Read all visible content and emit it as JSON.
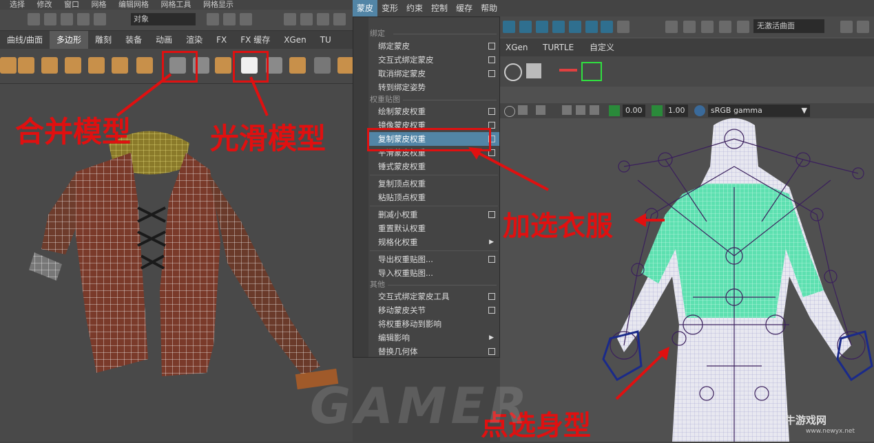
{
  "left": {
    "menubar": [
      "选择",
      "修改",
      "窗口",
      "网格",
      "编辑网格",
      "网格工具",
      "网格显示"
    ],
    "object_field": "对象",
    "tabs": [
      "曲线/曲面",
      "多边形",
      "雕刻",
      "装备",
      "动画",
      "渲染",
      "FX",
      "FX 缓存",
      "XGen",
      "TU"
    ],
    "active_tab": "多边形"
  },
  "menu": {
    "bar": [
      "蒙皮",
      "变形",
      "约束",
      "控制",
      "缓存",
      "帮助"
    ],
    "active": "蒙皮",
    "sections": {
      "bind": "绑定",
      "weight_maps": "权重贴图",
      "other": "其他"
    },
    "items": {
      "bind_skin": "绑定蒙皮",
      "interactive_bind": "交互式绑定蒙皮",
      "unbind_skin": "取消绑定蒙皮",
      "go_to_bind_pose": "转到绑定姿势",
      "paint_weights": "绘制蒙皮权重",
      "mirror_weights": "镜像蒙皮权重",
      "copy_weights": "复制蒙皮权重",
      "smooth_weights": "平滑蒙皮权重",
      "hammer_weights": "锤式蒙皮权重",
      "copy_vertex_weights": "复制顶点权重",
      "paste_vertex_weights": "粘贴顶点权重",
      "prune_weights": "删减小权重",
      "reset_weights": "重置默认权重",
      "normalize_weights": "规格化权重",
      "export_weight_maps": "导出权重贴图...",
      "import_weight_maps": "导入权重贴图...",
      "interactive_bind_tool": "交互式绑定蒙皮工具",
      "move_skin_joints": "移动蒙皮关节",
      "move_weights_to_influences": "将权重移动到影响",
      "edit_influences": "编辑影响",
      "substitute_geometry": "替换几何体"
    }
  },
  "right": {
    "curve_field": "无激活曲面",
    "tabs": [
      "XGen",
      "TURTLE",
      "自定义"
    ],
    "gamma_value_1": "0.00",
    "gamma_value_2": "1.00",
    "colorspace": "sRGB gamma"
  },
  "annotations": {
    "combine": "合并模型",
    "smooth": "光滑模型",
    "add_clothes": "加选衣服",
    "select_body": "点选身型"
  },
  "watermark": "GAMER",
  "logo": {
    "name": "牛游戏网",
    "url": "www.newyx.net"
  },
  "colors": {
    "highlight": "#5285a6",
    "annotation": "#e01010",
    "garment": "#7a5a3a",
    "skin_mesh": "#5de0b0",
    "skeleton": "#3a1f5c"
  }
}
